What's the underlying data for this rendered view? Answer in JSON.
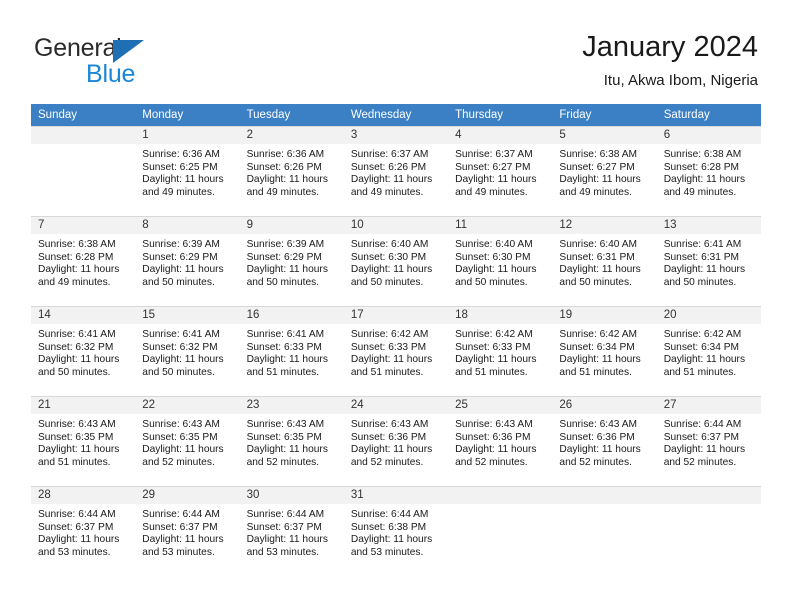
{
  "brand": {
    "name_part1": "General",
    "name_part2": "Blue",
    "triangle_color": "#1f6fb5",
    "blue_color": "#1a86d8"
  },
  "header": {
    "title": "January 2024",
    "subtitle": "Itu, Akwa Ibom, Nigeria"
  },
  "theme": {
    "header_row_bg": "#3b7fc4",
    "header_row_text": "#ffffff",
    "daynum_bg": "#f2f2f2",
    "grid_line": "#d8d8d8"
  },
  "columns": [
    "Sunday",
    "Monday",
    "Tuesday",
    "Wednesday",
    "Thursday",
    "Friday",
    "Saturday"
  ],
  "weeks": [
    [
      {
        "day": "",
        "blank": true,
        "lines": []
      },
      {
        "day": "1",
        "lines": [
          "Sunrise: 6:36 AM",
          "Sunset: 6:25 PM",
          "Daylight: 11 hours",
          "and 49 minutes."
        ]
      },
      {
        "day": "2",
        "lines": [
          "Sunrise: 6:36 AM",
          "Sunset: 6:26 PM",
          "Daylight: 11 hours",
          "and 49 minutes."
        ]
      },
      {
        "day": "3",
        "lines": [
          "Sunrise: 6:37 AM",
          "Sunset: 6:26 PM",
          "Daylight: 11 hours",
          "and 49 minutes."
        ]
      },
      {
        "day": "4",
        "lines": [
          "Sunrise: 6:37 AM",
          "Sunset: 6:27 PM",
          "Daylight: 11 hours",
          "and 49 minutes."
        ]
      },
      {
        "day": "5",
        "lines": [
          "Sunrise: 6:38 AM",
          "Sunset: 6:27 PM",
          "Daylight: 11 hours",
          "and 49 minutes."
        ]
      },
      {
        "day": "6",
        "lines": [
          "Sunrise: 6:38 AM",
          "Sunset: 6:28 PM",
          "Daylight: 11 hours",
          "and 49 minutes."
        ]
      }
    ],
    [
      {
        "day": "7",
        "lines": [
          "Sunrise: 6:38 AM",
          "Sunset: 6:28 PM",
          "Daylight: 11 hours",
          "and 49 minutes."
        ]
      },
      {
        "day": "8",
        "lines": [
          "Sunrise: 6:39 AM",
          "Sunset: 6:29 PM",
          "Daylight: 11 hours",
          "and 50 minutes."
        ]
      },
      {
        "day": "9",
        "lines": [
          "Sunrise: 6:39 AM",
          "Sunset: 6:29 PM",
          "Daylight: 11 hours",
          "and 50 minutes."
        ]
      },
      {
        "day": "10",
        "lines": [
          "Sunrise: 6:40 AM",
          "Sunset: 6:30 PM",
          "Daylight: 11 hours",
          "and 50 minutes."
        ]
      },
      {
        "day": "11",
        "lines": [
          "Sunrise: 6:40 AM",
          "Sunset: 6:30 PM",
          "Daylight: 11 hours",
          "and 50 minutes."
        ]
      },
      {
        "day": "12",
        "lines": [
          "Sunrise: 6:40 AM",
          "Sunset: 6:31 PM",
          "Daylight: 11 hours",
          "and 50 minutes."
        ]
      },
      {
        "day": "13",
        "lines": [
          "Sunrise: 6:41 AM",
          "Sunset: 6:31 PM",
          "Daylight: 11 hours",
          "and 50 minutes."
        ]
      }
    ],
    [
      {
        "day": "14",
        "lines": [
          "Sunrise: 6:41 AM",
          "Sunset: 6:32 PM",
          "Daylight: 11 hours",
          "and 50 minutes."
        ]
      },
      {
        "day": "15",
        "lines": [
          "Sunrise: 6:41 AM",
          "Sunset: 6:32 PM",
          "Daylight: 11 hours",
          "and 50 minutes."
        ]
      },
      {
        "day": "16",
        "lines": [
          "Sunrise: 6:41 AM",
          "Sunset: 6:33 PM",
          "Daylight: 11 hours",
          "and 51 minutes."
        ]
      },
      {
        "day": "17",
        "lines": [
          "Sunrise: 6:42 AM",
          "Sunset: 6:33 PM",
          "Daylight: 11 hours",
          "and 51 minutes."
        ]
      },
      {
        "day": "18",
        "lines": [
          "Sunrise: 6:42 AM",
          "Sunset: 6:33 PM",
          "Daylight: 11 hours",
          "and 51 minutes."
        ]
      },
      {
        "day": "19",
        "lines": [
          "Sunrise: 6:42 AM",
          "Sunset: 6:34 PM",
          "Daylight: 11 hours",
          "and 51 minutes."
        ]
      },
      {
        "day": "20",
        "lines": [
          "Sunrise: 6:42 AM",
          "Sunset: 6:34 PM",
          "Daylight: 11 hours",
          "and 51 minutes."
        ]
      }
    ],
    [
      {
        "day": "21",
        "lines": [
          "Sunrise: 6:43 AM",
          "Sunset: 6:35 PM",
          "Daylight: 11 hours",
          "and 51 minutes."
        ]
      },
      {
        "day": "22",
        "lines": [
          "Sunrise: 6:43 AM",
          "Sunset: 6:35 PM",
          "Daylight: 11 hours",
          "and 52 minutes."
        ]
      },
      {
        "day": "23",
        "lines": [
          "Sunrise: 6:43 AM",
          "Sunset: 6:35 PM",
          "Daylight: 11 hours",
          "and 52 minutes."
        ]
      },
      {
        "day": "24",
        "lines": [
          "Sunrise: 6:43 AM",
          "Sunset: 6:36 PM",
          "Daylight: 11 hours",
          "and 52 minutes."
        ]
      },
      {
        "day": "25",
        "lines": [
          "Sunrise: 6:43 AM",
          "Sunset: 6:36 PM",
          "Daylight: 11 hours",
          "and 52 minutes."
        ]
      },
      {
        "day": "26",
        "lines": [
          "Sunrise: 6:43 AM",
          "Sunset: 6:36 PM",
          "Daylight: 11 hours",
          "and 52 minutes."
        ]
      },
      {
        "day": "27",
        "lines": [
          "Sunrise: 6:44 AM",
          "Sunset: 6:37 PM",
          "Daylight: 11 hours",
          "and 52 minutes."
        ]
      }
    ],
    [
      {
        "day": "28",
        "lines": [
          "Sunrise: 6:44 AM",
          "Sunset: 6:37 PM",
          "Daylight: 11 hours",
          "and 53 minutes."
        ]
      },
      {
        "day": "29",
        "lines": [
          "Sunrise: 6:44 AM",
          "Sunset: 6:37 PM",
          "Daylight: 11 hours",
          "and 53 minutes."
        ]
      },
      {
        "day": "30",
        "lines": [
          "Sunrise: 6:44 AM",
          "Sunset: 6:37 PM",
          "Daylight: 11 hours",
          "and 53 minutes."
        ]
      },
      {
        "day": "31",
        "lines": [
          "Sunrise: 6:44 AM",
          "Sunset: 6:38 PM",
          "Daylight: 11 hours",
          "and 53 minutes."
        ]
      },
      {
        "day": "",
        "blank": true,
        "lines": []
      },
      {
        "day": "",
        "blank": true,
        "lines": []
      },
      {
        "day": "",
        "blank": true,
        "lines": []
      }
    ]
  ]
}
